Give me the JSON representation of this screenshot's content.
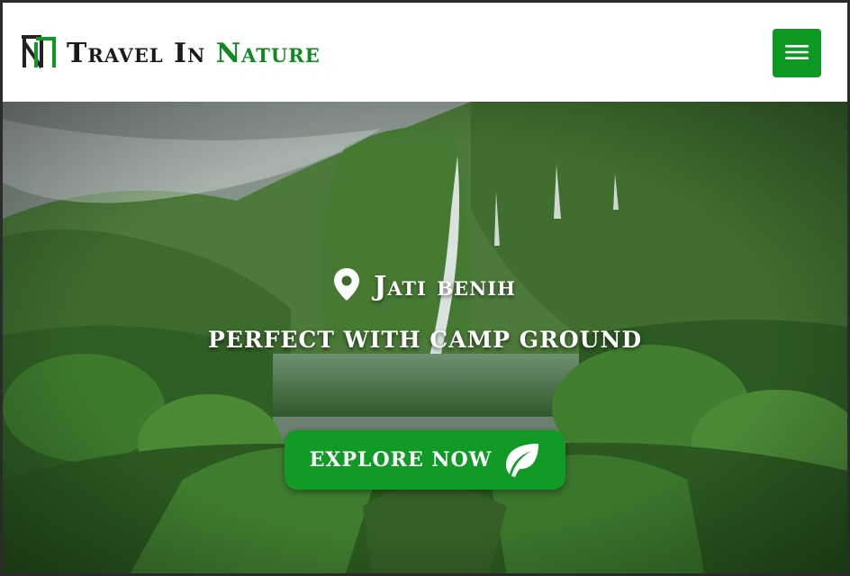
{
  "header": {
    "brand_first": "Travel In",
    "brand_accent": "Nature",
    "logo_icon": "tn-monogram-icon",
    "menu_icon": "hamburger-menu-icon",
    "accent_color": "#0e9a22"
  },
  "hero": {
    "location_icon": "map-pin-icon",
    "location": "Jati benih",
    "tagline": "perfect with camp ground",
    "cta_label": "explore now",
    "cta_icon": "leaf-icon",
    "background": "waterfall-valley-photo"
  }
}
